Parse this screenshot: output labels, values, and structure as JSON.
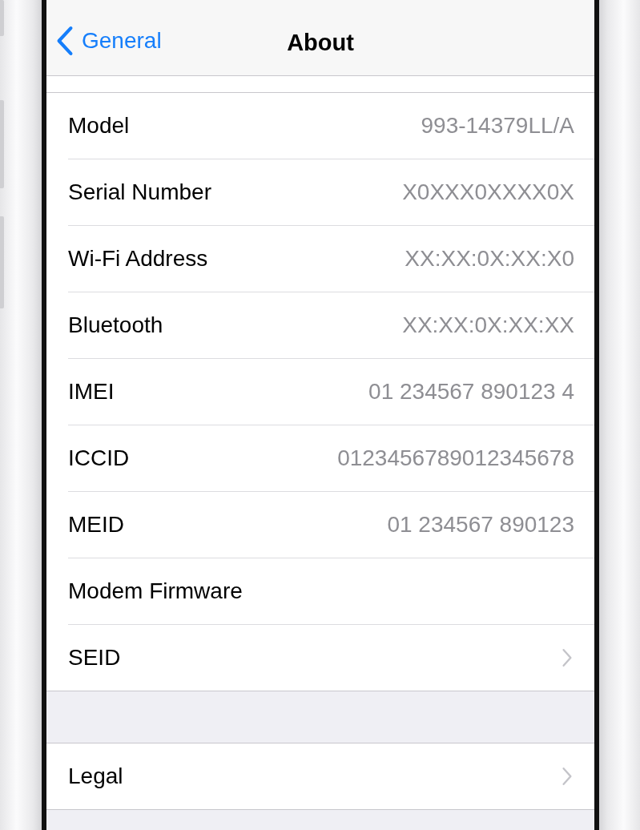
{
  "nav": {
    "back_label": "General",
    "title": "About"
  },
  "sections": [
    {
      "rows": [
        {
          "kind": "value",
          "label": "Model",
          "value": "993-14379LL/A"
        },
        {
          "kind": "value",
          "label": "Serial Number",
          "value": "X0XXX0XXXX0X"
        },
        {
          "kind": "value",
          "label": "Wi-Fi Address",
          "value": "XX:XX:0X:XX:X0"
        },
        {
          "kind": "value",
          "label": "Bluetooth",
          "value": "XX:XX:0X:XX:XX"
        },
        {
          "kind": "value",
          "label": "IMEI",
          "value": "01 234567 890123 4"
        },
        {
          "kind": "value",
          "label": "ICCID",
          "value": "0123456789012345678"
        },
        {
          "kind": "value",
          "label": "MEID",
          "value": "01 234567 890123"
        },
        {
          "kind": "plain",
          "label": "Modem Firmware"
        },
        {
          "kind": "disclosure",
          "label": "SEID"
        }
      ]
    },
    {
      "rows": [
        {
          "kind": "disclosure",
          "label": "Legal"
        }
      ]
    }
  ]
}
